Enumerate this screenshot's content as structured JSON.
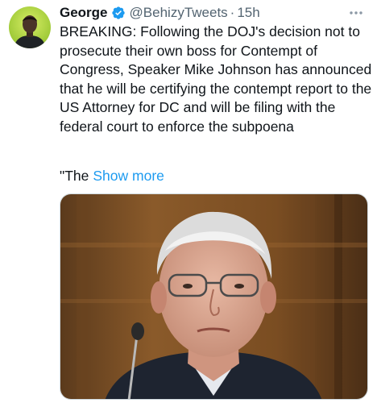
{
  "tweet": {
    "author": {
      "display_name": "George",
      "handle": "@BehizyTweets",
      "verified": true,
      "avatar_icon": "profile-avatar"
    },
    "separator": "·",
    "timestamp": "15h",
    "more_icon": "more-options-icon",
    "text": "BREAKING: Following the DOJ's decision not to prosecute their own boss for Contempt of Congress, Speaker Mike Johnson has announced that he will be certifying the contempt report to the US Attorney for DC and will be filing with the federal court to enforce the subpoena",
    "truncated_text": "\"The",
    "show_more_label": "Show more",
    "media": {
      "type": "photo"
    }
  },
  "colors": {
    "link": "#1d9bf0",
    "text": "#0f1419",
    "secondary": "#536471",
    "verified": "#1d9bf0"
  }
}
